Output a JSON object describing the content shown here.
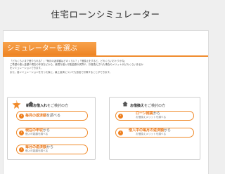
{
  "page": {
    "title": "住宅ローンシミュレーター"
  },
  "section": {
    "header": "シミュレーターを選ぶ"
  },
  "intro": {
    "lines": [
      "「どれくらいまで借りられる？」「毎月の返済額はどのくらい？」「借換えをすると、どれくらいおトクかな」",
      "ご希望の借入金額や現在の年収などから、最適な借入可能金額の試算や、お借換えされた場合のメリットがどれくらいあるか",
      "をシミュレーションできます。",
      "また、各シミュレーションを行った後に、繰上返済についても追加で計算することができます。"
    ]
  },
  "new_loan": {
    "tag": "NEW",
    "title_bold": "新規お借入れ",
    "title_rest": "をご検討の方",
    "buttons": [
      {
        "line1_bold": "毎月の返済額",
        "line1_rest": "を調べる",
        "line2": ""
      },
      {
        "line1_bold": "現在の年収",
        "line1_rest": "から",
        "line2": "借入可能額を調べる"
      },
      {
        "line1_bold": "毎月の返済額",
        "line1_rest": "から",
        "line2": "借入可能額を調べる"
      }
    ]
  },
  "refinance": {
    "title_bold": "お借換え",
    "title_rest": "をご検討の方",
    "buttons": [
      {
        "line1_bold": "ローン残高",
        "line1_rest": "から",
        "line2": "お借換えメリットを調べる"
      },
      {
        "line1_bold": "借入中の毎月の返済額",
        "line1_rest": "から",
        "line2": "お借換えメリットを調べる"
      }
    ]
  }
}
